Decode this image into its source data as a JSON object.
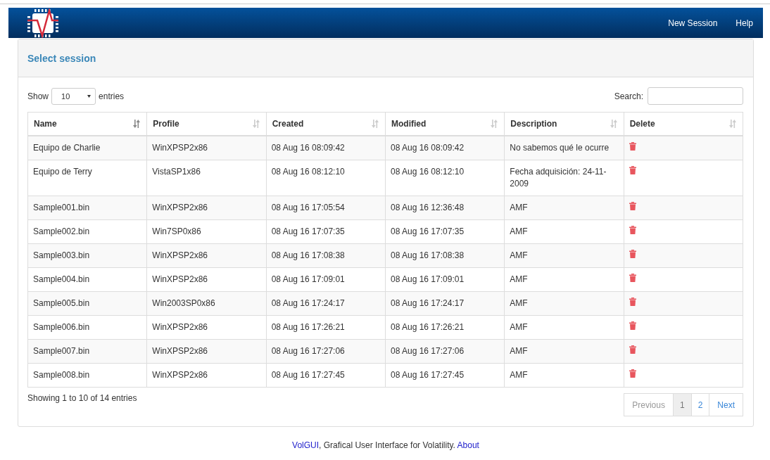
{
  "navbar": {
    "links": [
      "New Session",
      "Help"
    ]
  },
  "panel": {
    "title": "Select session"
  },
  "length": {
    "before": "Show",
    "value": "10",
    "after": "entries"
  },
  "search": {
    "label": "Search:"
  },
  "table": {
    "columns": [
      {
        "label": "Name",
        "sorted": true
      },
      {
        "label": "Profile",
        "sorted": false
      },
      {
        "label": "Created",
        "sorted": false
      },
      {
        "label": "Modified",
        "sorted": false
      },
      {
        "label": "Description",
        "sorted": false
      },
      {
        "label": "Delete",
        "sorted": false
      }
    ],
    "rows": [
      {
        "name": "Equipo de Charlie",
        "profile": "WinXPSP2x86",
        "created": "08 Aug 16 08:09:42",
        "modified": "08 Aug 16 08:09:42",
        "description": "No sabemos qué le ocurre"
      },
      {
        "name": "Equipo de Terry",
        "profile": "VistaSP1x86",
        "created": "08 Aug 16 08:12:10",
        "modified": "08 Aug 16 08:12:10",
        "description": "Fecha adquisición: 24-11-2009"
      },
      {
        "name": "Sample001.bin",
        "profile": "WinXPSP2x86",
        "created": "08 Aug 16 17:05:54",
        "modified": "08 Aug 16 12:36:48",
        "description": "AMF"
      },
      {
        "name": "Sample002.bin",
        "profile": "Win7SP0x86",
        "created": "08 Aug 16 17:07:35",
        "modified": "08 Aug 16 17:07:35",
        "description": "AMF"
      },
      {
        "name": "Sample003.bin",
        "profile": "WinXPSP2x86",
        "created": "08 Aug 16 17:08:38",
        "modified": "08 Aug 16 17:08:38",
        "description": "AMF"
      },
      {
        "name": "Sample004.bin",
        "profile": "WinXPSP2x86",
        "created": "08 Aug 16 17:09:01",
        "modified": "08 Aug 16 17:09:01",
        "description": "AMF"
      },
      {
        "name": "Sample005.bin",
        "profile": "Win2003SP0x86",
        "created": "08 Aug 16 17:24:17",
        "modified": "08 Aug 16 17:24:17",
        "description": "AMF"
      },
      {
        "name": "Sample006.bin",
        "profile": "WinXPSP2x86",
        "created": "08 Aug 16 17:26:21",
        "modified": "08 Aug 16 17:26:21",
        "description": "AMF"
      },
      {
        "name": "Sample007.bin",
        "profile": "WinXPSP2x86",
        "created": "08 Aug 16 17:27:06",
        "modified": "08 Aug 16 17:27:06",
        "description": "AMF"
      },
      {
        "name": "Sample008.bin",
        "profile": "WinXPSP2x86",
        "created": "08 Aug 16 17:27:45",
        "modified": "08 Aug 16 17:27:45",
        "description": "AMF"
      }
    ]
  },
  "info": "Showing 1 to 10 of 14 entries",
  "pagination": [
    {
      "label": "Previous",
      "kind": "prev",
      "disabled": true,
      "selected": false
    },
    {
      "label": "1",
      "kind": "page",
      "disabled": false,
      "selected": true
    },
    {
      "label": "2",
      "kind": "page",
      "disabled": false,
      "selected": false
    },
    {
      "label": "Next",
      "kind": "next",
      "disabled": false,
      "selected": false
    }
  ],
  "footer": {
    "brand": "VolGUI",
    "text": ", Grafical User Interface for Volatility.",
    "link": "About"
  }
}
